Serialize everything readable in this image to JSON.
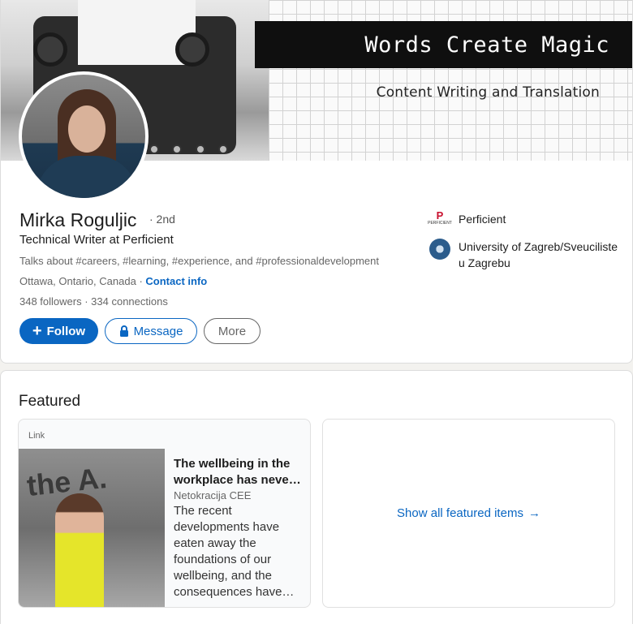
{
  "banner": {
    "title": "Words Create Magic",
    "subtitle": "Content Writing and Translation"
  },
  "profile": {
    "name": "Mirka Roguljic",
    "degree": "· 2nd",
    "headline": "Technical Writer at Perficient",
    "talks_about": "Talks about #careers, #learning, #experience, and #professionaldevelopment",
    "location": "Ottawa, Ontario, Canada",
    "location_sep": "·",
    "contact_info": "Contact info",
    "followers": "348 followers",
    "connections": "· 334 connections"
  },
  "actions": {
    "follow": "Follow",
    "follow_icon": "+",
    "message": "Message",
    "more": "More"
  },
  "side": {
    "company": "Perficient",
    "company_logo_text": "PERFICIENT",
    "school": "University of Zagreb/Sveuciliste u Zagrebu"
  },
  "featured": {
    "title": "Featured",
    "card": {
      "kind": "Link",
      "image_text": "the A.",
      "headline": "The wellbeing in the workplace has neve…",
      "source": "Netokracija CEE",
      "description": "The recent developments have eaten away the foundations of our wellbeing, and the consequences have…"
    },
    "show_all": "Show all featured items",
    "show_all_arrow": "→"
  },
  "colors": {
    "accent": "#0a66c2",
    "perficient_red": "#c8102e"
  }
}
